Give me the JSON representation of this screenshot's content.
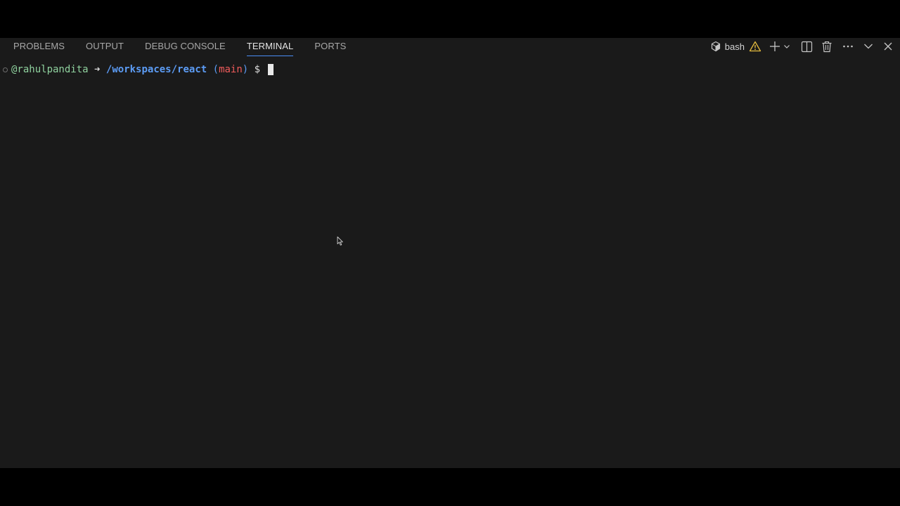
{
  "tabs": [
    {
      "label": "PROBLEMS",
      "active": false
    },
    {
      "label": "OUTPUT",
      "active": false
    },
    {
      "label": "DEBUG CONSOLE",
      "active": false
    },
    {
      "label": "TERMINAL",
      "active": true
    },
    {
      "label": "PORTS",
      "active": false
    }
  ],
  "actions": {
    "shell_label": "bash",
    "icons": [
      "shell-cube-icon",
      "warning-icon",
      "plus-icon",
      "chevron-down-icon",
      "split-terminal-icon",
      "trash-icon",
      "more-icon",
      "chevron-down-icon",
      "close-icon"
    ]
  },
  "terminal": {
    "user": "@rahulpandita",
    "arrow": "➜",
    "path": "/workspaces/react",
    "branch_open": "(",
    "branch": "main",
    "branch_close": ")",
    "prompt": "$"
  },
  "colors": {
    "background": "#1a1a1a",
    "active_tab_underline": "#4b8ef7",
    "user": "#8fd19e",
    "path": "#5c9cf5",
    "branch": "#ef5b5b",
    "warning": "#e2b93d"
  }
}
